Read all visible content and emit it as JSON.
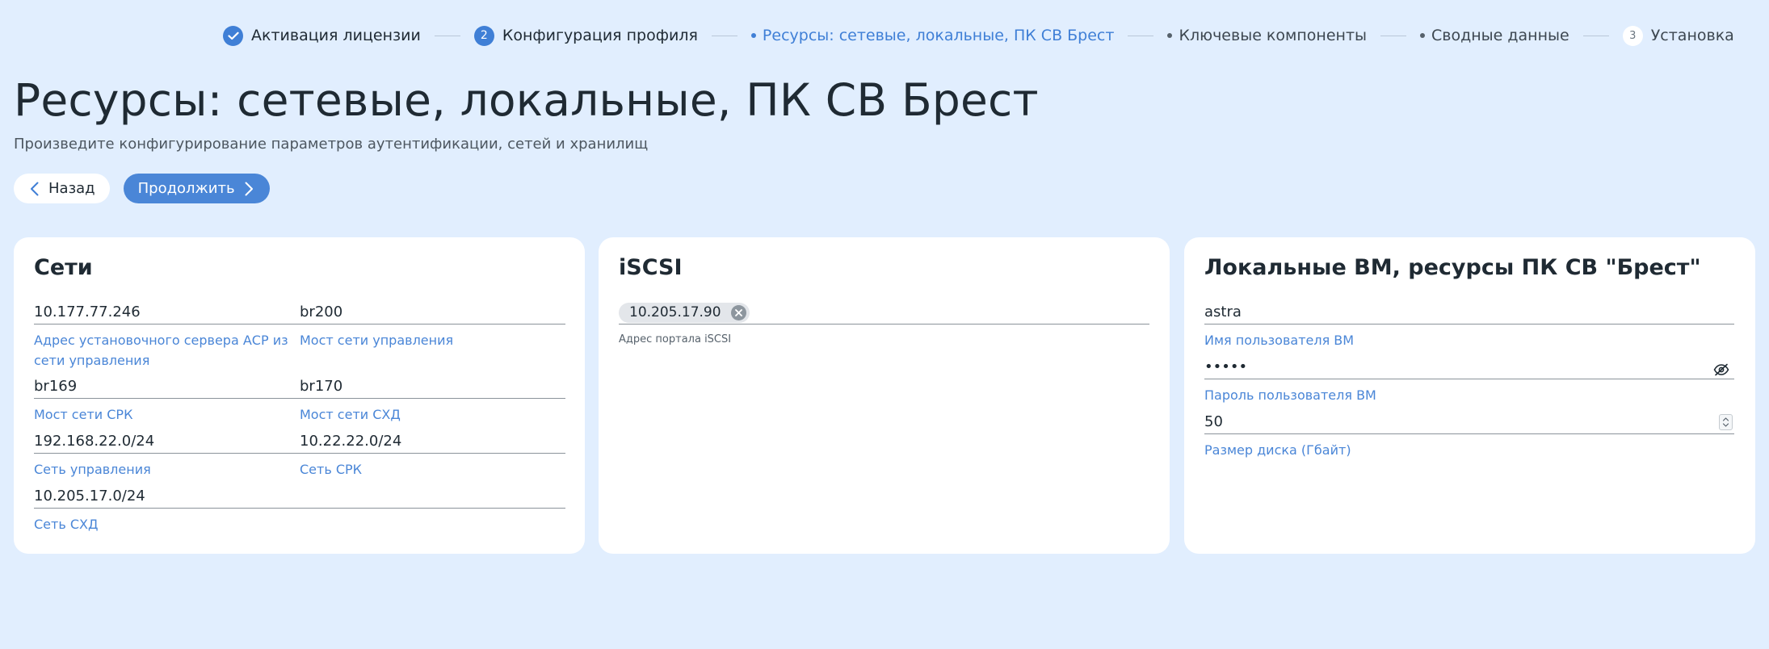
{
  "stepper": {
    "steps": [
      {
        "label": "Активация лицензии",
        "state": "done",
        "icon": "check-icon"
      },
      {
        "label": "Конфигурация профиля",
        "state": "current-group",
        "number": "2"
      },
      {
        "label": "Ресурсы: сетевые, локальные, ПК СВ Брест",
        "state": "active"
      },
      {
        "label": "Ключевые компоненты",
        "state": "pending"
      },
      {
        "label": "Сводные данные",
        "state": "pending"
      },
      {
        "label": "Установка",
        "state": "pending",
        "number": "3"
      }
    ]
  },
  "header": {
    "title": "Ресурсы: сетевые, локальные, ПК СВ Брест",
    "subtitle": "Произведите конфигурирование параметров аутентификации, сетей и хранилищ"
  },
  "actions": {
    "back_label": "Назад",
    "next_label": "Продолжить"
  },
  "networks": {
    "title": "Сети",
    "install_server": {
      "value": "10.177.77.246",
      "label": "Адрес установочного сервера АСР из сети управления"
    },
    "mgmt_bridge": {
      "value": "br200",
      "label": "Мост сети управления"
    },
    "srk_bridge": {
      "value": "br169",
      "label": "Мост сети СРК"
    },
    "shd_bridge": {
      "value": "br170",
      "label": "Мост сети СХД"
    },
    "mgmt_network": {
      "value": "192.168.22.0/24",
      "label": "Сеть управления"
    },
    "srk_network": {
      "value": "10.22.22.0/24",
      "label": "Сеть СРК"
    },
    "shd_network": {
      "value": "10.205.17.0/24",
      "label": "Сеть СХД"
    }
  },
  "iscsi": {
    "title": "iSCSI",
    "portals": [
      "10.205.17.90"
    ],
    "label": "Адрес портала iSCSI"
  },
  "local_vm": {
    "title": "Локальные ВМ, ресурсы ПК СВ \"Брест\"",
    "username": {
      "value": "astra",
      "label": "Имя пользователя ВМ"
    },
    "password": {
      "value": "•••••",
      "label": "Пароль пользователя ВМ"
    },
    "disk_size": {
      "value": "50",
      "label": "Размер диска (Гбайт)"
    }
  },
  "colors": {
    "background": "#e1eefe",
    "accent": "#4a86d7",
    "card": "#ffffff"
  }
}
